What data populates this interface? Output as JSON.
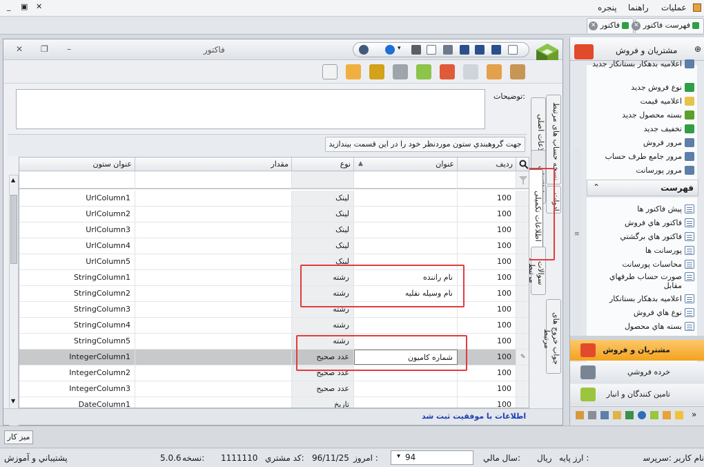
{
  "menubar": {
    "items": [
      "عمليات",
      "راهنما",
      "پنجره"
    ],
    "window_buttons": [
      "_",
      "▣",
      "✕"
    ]
  },
  "doc_tabs": [
    {
      "label": "فهرست فاکتور"
    },
    {
      "label": "فاکتور"
    }
  ],
  "window": {
    "title": "فاکتور",
    "controls": [
      "✕",
      "❐",
      "–"
    ]
  },
  "description": {
    "label": "توضيحات:",
    "value": ""
  },
  "vertical_tabs": {
    "right_col": [
      "اطلاعات اصلی",
      "اطلاعات پرداخت",
      "اطلاعات تکمیلی",
      "سوالات مرتبط"
    ],
    "far_col": [
      "نسخه حساب های مرتبط",
      "ادوات",
      "جواب خروج های مرتبط"
    ]
  },
  "grid": {
    "group_hint": "جهت گروهبندي ستون موردنظر خود را در اين قسمت بيندازيد",
    "columns": {
      "id": "رديف",
      "title": "عنوان",
      "type": "نوع",
      "value": "مقدار",
      "column_title": "عنوان ستون"
    },
    "rows": [
      {
        "id": "100",
        "title": "",
        "type": "لينک",
        "value": "",
        "column_title": "UrlColumn1"
      },
      {
        "id": "100",
        "title": "",
        "type": "لينک",
        "value": "",
        "column_title": "UrlColumn2"
      },
      {
        "id": "100",
        "title": "",
        "type": "لينک",
        "value": "",
        "column_title": "UrlColumn3"
      },
      {
        "id": "100",
        "title": "",
        "type": "لينک",
        "value": "",
        "column_title": "UrlColumn4"
      },
      {
        "id": "100",
        "title": "",
        "type": "لينک",
        "value": "",
        "column_title": "UrlColumn5"
      },
      {
        "id": "100",
        "title": "نام راننده",
        "type": "رشته",
        "value": "",
        "column_title": "StringColumn1"
      },
      {
        "id": "100",
        "title": "نام وسيله نقليه",
        "type": "رشته",
        "value": "",
        "column_title": "StringColumn2"
      },
      {
        "id": "100",
        "title": "",
        "type": "رشته",
        "value": "",
        "column_title": "StringColumn3"
      },
      {
        "id": "100",
        "title": "",
        "type": "رشته",
        "value": "",
        "column_title": "StringColumn4"
      },
      {
        "id": "100",
        "title": "",
        "type": "رشته",
        "value": "",
        "column_title": "StringColumn5"
      },
      {
        "id": "100",
        "title": "شماره کاميون",
        "type": "عدد صحيح",
        "value": "",
        "column_title": "IntegerColumn1"
      },
      {
        "id": "100",
        "title": "",
        "type": "عدد صحيح",
        "value": "",
        "column_title": "IntegerColumn2"
      },
      {
        "id": "100",
        "title": "",
        "type": "عدد صحيح",
        "value": "",
        "column_title": "IntegerColumn3"
      },
      {
        "id": "100",
        "title": "",
        "type": "تاريخ",
        "value": "",
        "column_title": "DateColumn1"
      }
    ]
  },
  "status": {
    "message": "اطلاعات با موفقيت ثبت شد"
  },
  "right_panel": {
    "header": "مشتريان و فروش",
    "top_items": [
      "اعلاميه بدهکار بستانکار جديد",
      "نوع فروش جديد",
      "اعلاميه قيمت",
      "بسته محصول جديد",
      "تخفيف جديد",
      "مرور فروش",
      "مرور جامع طرف حساب",
      "مرور پورسانت"
    ],
    "section_title": "فهرست",
    "list_items": [
      "پيش فاکتور ها",
      "فاکتور هاي فروش",
      "فاکتور هاي برگشتي",
      "پورسانت ها",
      "محاسبات پورسانت",
      "صورت حساب طرفهاي مقابل",
      "اعلاميه بدهکار بستانکار",
      "نوع هاي فروش",
      "بسته هاي محصول"
    ],
    "nav_buttons": [
      {
        "label": "مشتريان و فروش"
      },
      {
        "label": "خرده فروشي"
      },
      {
        "label": "تامين کنندگان و انبار"
      }
    ]
  },
  "desk": {
    "button": "ميز کار"
  },
  "statusbar": {
    "user": "نام کاربر :سرپرست",
    "currency_label": "ارز پايه :",
    "currency": "ريال",
    "fiscal_label": "سال مالي:",
    "fiscal_year": "94",
    "today_label": "امروز :",
    "today": "96/11/25",
    "customer_code_label": "کد مشتري:",
    "customer_code": "1111110",
    "version_label": "نسخه:",
    "version": "5.0.6",
    "support": "پشتيباني و آموزش"
  },
  "colors": {
    "highlight_box": "#e03c3c",
    "status_text": "#1b3fb3",
    "nav_active": "#f3a21f"
  }
}
